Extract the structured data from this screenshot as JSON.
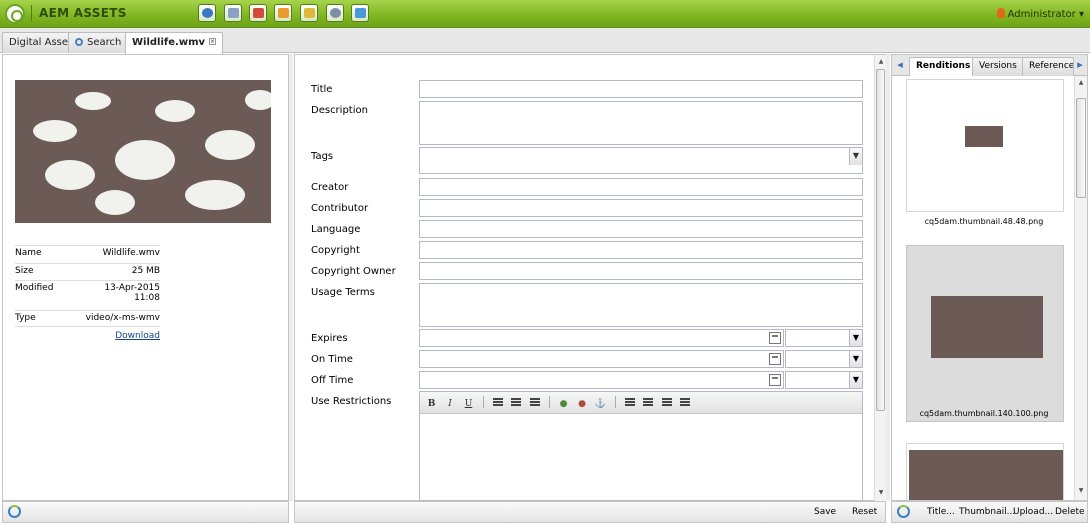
{
  "app": {
    "title": "AEM ASSETS",
    "user": "Administrator"
  },
  "toolbar_icons": [
    "globe-icon",
    "assets-icon",
    "inbox-icon",
    "mail-icon",
    "users-icon",
    "gear-icon",
    "tag-icon"
  ],
  "tabs": [
    {
      "label": "Digital Assets"
    },
    {
      "label": "Search"
    },
    {
      "label": "Wildlife.wmv"
    }
  ],
  "asset": {
    "meta": [
      {
        "key": "Name",
        "value": "Wildlife.wmv"
      },
      {
        "key": "Size",
        "value": "25 MB"
      },
      {
        "key": "Modified",
        "value": "13-Apr-2015 11:08"
      },
      {
        "key": "Type",
        "value": "video/x-ms-wmv"
      }
    ],
    "download": "Download"
  },
  "form": {
    "labels": [
      "Title",
      "Description",
      "Tags",
      "Creator",
      "Contributor",
      "Language",
      "Copyright",
      "Copyright Owner",
      "Usage Terms",
      "Expires",
      "On Time",
      "Off Time",
      "Use Restrictions"
    ],
    "rte_buttons": [
      "B",
      "I",
      "U"
    ]
  },
  "footer": {
    "save": "Save",
    "reset": "Reset",
    "actions": [
      "Title...",
      "Thumbnail...",
      "Upload...",
      "Delete"
    ]
  },
  "right_tabs": [
    "Renditions",
    "Versions",
    "References"
  ],
  "renditions": [
    "cq5dam.thumbnail.48.48.png",
    "cq5dam.thumbnail.140.100.png"
  ]
}
